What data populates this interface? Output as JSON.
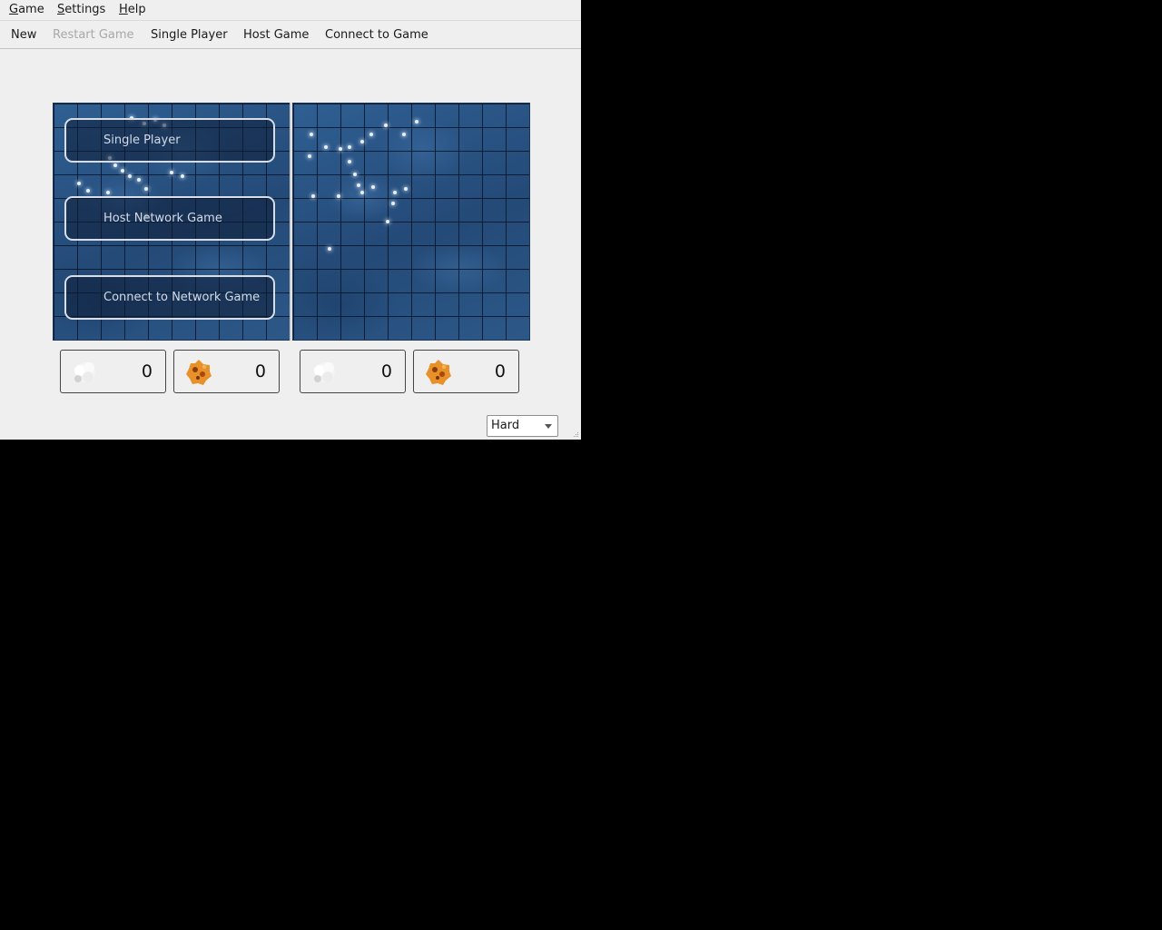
{
  "menubar": {
    "items": [
      {
        "label": "Game",
        "mnemonic": "G"
      },
      {
        "label": "Settings",
        "mnemonic": "S"
      },
      {
        "label": "Help",
        "mnemonic": "H"
      }
    ]
  },
  "toolbar": {
    "new_label": "New",
    "restart_label": "Restart Game",
    "single_player_label": "Single Player",
    "host_label": "Host Game",
    "connect_label": "Connect to Game"
  },
  "overlay": {
    "single_player_label": "Single Player",
    "host_network_label": "Host Network Game",
    "connect_network_label": "Connect to Network Game"
  },
  "stats": {
    "player1": {
      "miss_count": "0",
      "hit_count": "0"
    },
    "player2": {
      "miss_count": "0",
      "hit_count": "0"
    }
  },
  "difficulty": {
    "selected": "Hard"
  },
  "icons": {
    "miss": "splash-miss-icon",
    "hit": "fire-hit-icon",
    "dropdown": "chevron-down-icon"
  },
  "colors": {
    "sea": "#2a5382",
    "grid": "#0a1a30",
    "hit": "#e8902a"
  }
}
